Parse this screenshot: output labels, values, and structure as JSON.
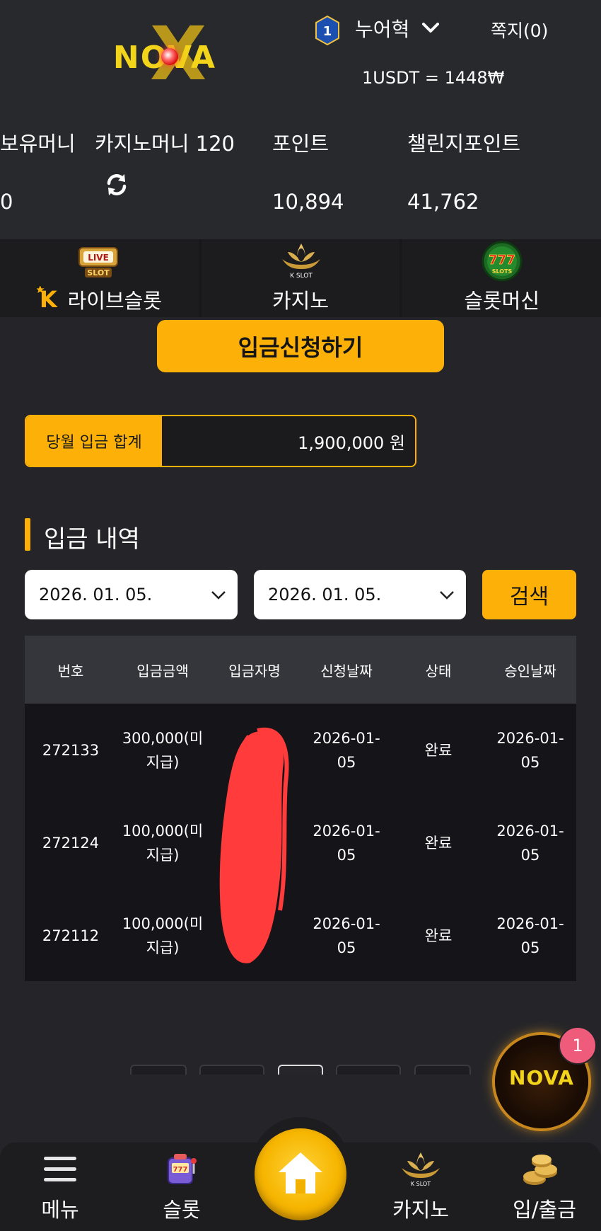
{
  "brand": {
    "logo_text": "NOVA"
  },
  "header": {
    "level": "1",
    "user_name": "누어혁",
    "messages_label": "쪽지(0)",
    "exchange_rate": "1USDT = 1448₩"
  },
  "balances": {
    "held_label": "보유머니",
    "held_value": "0",
    "casino_label": "카지노머니 120",
    "points_label": "포인트",
    "points_value": "10,894",
    "challenge_label": "챌린지포인트",
    "challenge_value": "41,762"
  },
  "game_tabs": [
    {
      "label": "라이브슬롯",
      "icon": "live-slot-icon"
    },
    {
      "label": "카지노",
      "icon": "k-slot-icon"
    },
    {
      "label": "슬롯머신",
      "icon": "777-slots-icon"
    }
  ],
  "deposit_button": "입금신청하기",
  "monthly": {
    "label": "당월 입금 합계",
    "value": "1,900,000 원"
  },
  "history": {
    "title": "입금 내역",
    "date_from": "2026. 01. 05.",
    "date_to": "2026. 01. 05.",
    "search_label": "검색",
    "columns": [
      "번호",
      "입금금액",
      "입금자명",
      "신청날짜",
      "상태",
      "승인날짜"
    ],
    "rows": [
      {
        "no": "272133",
        "amount_1": "300,000(미",
        "amount_2": "지급)",
        "date_1": "2026-01-",
        "date_2": "05",
        "status": "완료",
        "approved_1": "2026-01-",
        "approved_2": "05"
      },
      {
        "no": "272124",
        "amount_1": "100,000(미",
        "amount_2": "지급)",
        "date_1": "2026-01-",
        "date_2": "05",
        "status": "완료",
        "approved_1": "2026-01-",
        "approved_2": "05"
      },
      {
        "no": "272112",
        "amount_1": "100,000(미",
        "amount_2": "지급)",
        "date_1": "2026-01-",
        "date_2": "05",
        "status": "완료",
        "approved_1": "2026-01-",
        "approved_2": "05"
      }
    ]
  },
  "floating": {
    "badge_count": "1",
    "logo_text": "NOVA"
  },
  "bottom_nav": {
    "menu": "메뉴",
    "slot": "슬롯",
    "casino": "카지노",
    "deposit": "입/출금"
  },
  "colors": {
    "accent": "#fdb108",
    "background": "#252529",
    "redaction": "#ff3b3b"
  }
}
